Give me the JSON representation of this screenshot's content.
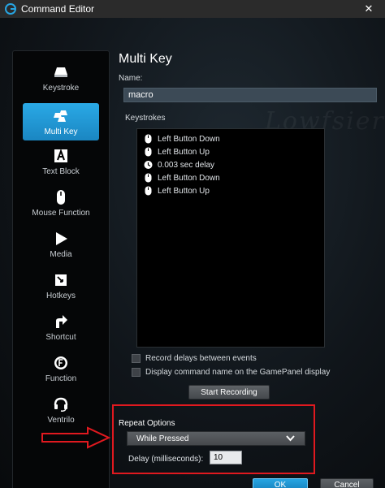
{
  "window": {
    "title": "Command Editor",
    "close_glyph": "✕"
  },
  "sidebar": {
    "items": [
      {
        "label": "Keystroke",
        "icon": "keycap-icon",
        "active": false
      },
      {
        "label": "Multi Key",
        "icon": "multi-keycap-icon",
        "active": true
      },
      {
        "label": "Text Block",
        "icon": "text-a-icon",
        "active": false
      },
      {
        "label": "Mouse Function",
        "icon": "mouse-icon",
        "active": false
      },
      {
        "label": "Media",
        "icon": "play-icon",
        "active": false
      },
      {
        "label": "Hotkeys",
        "icon": "hotkey-icon",
        "active": false
      },
      {
        "label": "Shortcut",
        "icon": "shortcut-arrow-icon",
        "active": false
      },
      {
        "label": "Function",
        "icon": "function-gear-icon",
        "active": false
      },
      {
        "label": "Ventrilo",
        "icon": "headset-icon",
        "active": false
      }
    ]
  },
  "main": {
    "title": "Multi Key",
    "name_label": "Name:",
    "name_value": "macro",
    "watermark": "Lowfsiersons",
    "keystrokes_label": "Keystrokes",
    "keystrokes": [
      {
        "text": "Left Button Down",
        "icon": "mouse-icon"
      },
      {
        "text": "Left Button Up",
        "icon": "mouse-icon"
      },
      {
        "text": "0.003 sec delay",
        "icon": "clock-icon"
      },
      {
        "text": "Left Button Down",
        "icon": "mouse-icon"
      },
      {
        "text": "Left Button Up",
        "icon": "mouse-icon"
      }
    ],
    "record_delays_label": "Record delays between events",
    "display_name_label": "Display command name on the GamePanel display",
    "start_recording_label": "Start Recording",
    "repeat_options_label": "Repeat Options",
    "repeat_selected": "While Pressed",
    "delay_label": "Delay (milliseconds):",
    "delay_value": "10",
    "ok_label": "OK",
    "cancel_label": "Cancel"
  },
  "colors": {
    "accent": "#1e96d6",
    "highlight_border": "#e0191f",
    "background": "#0c0f12"
  }
}
